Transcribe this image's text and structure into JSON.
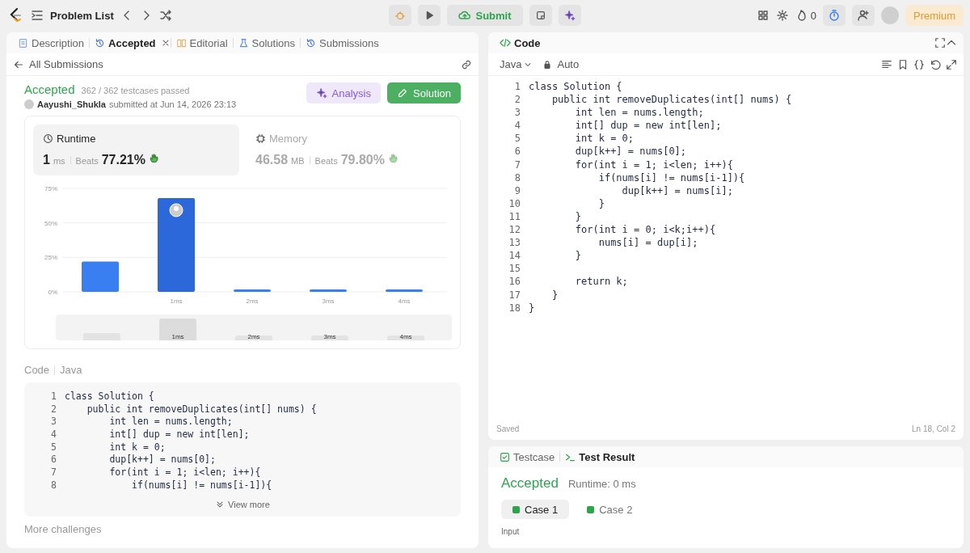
{
  "topbar": {
    "title": "Problem List",
    "submit": "Submit",
    "streak": "0",
    "premium": "Premium"
  },
  "left_tabs": [
    {
      "label": "Description",
      "selected": false,
      "kind": "doc"
    },
    {
      "label": "Accepted",
      "selected": true,
      "kind": "history",
      "closable": true
    },
    {
      "label": "Editorial",
      "selected": false,
      "kind": "book"
    },
    {
      "label": "Solutions",
      "selected": false,
      "kind": "flask"
    },
    {
      "label": "Submissions",
      "selected": false,
      "kind": "history"
    }
  ],
  "back_link": "All Submissions",
  "submission": {
    "status": "Accepted",
    "tests": "362 / 362 testcases passed",
    "user": "Aayushi_Shukla",
    "submitted": "submitted at Jun 14, 2026 23:13",
    "analysis": "Analysis",
    "solution": "Solution"
  },
  "metrics": [
    {
      "label": "Runtime",
      "kind": "clock",
      "value": "1",
      "unit": "ms",
      "beats_label": "Beats",
      "beats": "77.21%",
      "selected": true
    },
    {
      "label": "Memory",
      "kind": "chip",
      "value": "46.58",
      "unit": "MB",
      "beats_label": "Beats",
      "beats": "79.80%",
      "selected": false
    }
  ],
  "chart_data": {
    "type": "bar",
    "categories": [
      null,
      "1ms",
      "2ms",
      "3ms",
      "4ms"
    ],
    "values": [
      22,
      68,
      1,
      1,
      1
    ],
    "ylim": [
      0,
      75
    ],
    "yticks": [
      {
        "value": 0,
        "label": "0%"
      },
      {
        "value": 25,
        "label": "25%"
      },
      {
        "value": 50,
        "label": "50%"
      },
      {
        "value": 75,
        "label": "75%"
      }
    ],
    "annotations": [
      {
        "x": "1ms"
      }
    ]
  },
  "overview_labels": [
    "1ms",
    "2ms",
    "3ms",
    "4ms"
  ],
  "code_preview": {
    "title": "Code",
    "language": "Java",
    "view_more": "View more",
    "lines": [
      {
        "n": "1",
        "text": "class Solution {"
      },
      {
        "n": "2",
        "text": "    public int removeDuplicates(int[] nums) {"
      },
      {
        "n": "3",
        "text": "        int len = nums.length;"
      },
      {
        "n": "4",
        "text": "        int[] dup = new int[len];"
      },
      {
        "n": "5",
        "text": "        int k = 0;"
      },
      {
        "n": "6",
        "text": "        dup[k++] = nums[0];"
      },
      {
        "n": "7",
        "text": "        for(int i = 1; i<len; i++){"
      },
      {
        "n": "8",
        "text": "            if(nums[i] != nums[i-1]){"
      }
    ]
  },
  "more_challenges": "More challenges",
  "editor": {
    "title": "Code",
    "language": "Java",
    "mode": "Auto",
    "status": "Saved",
    "cursor": "Ln 18, Col 2",
    "lines": [
      {
        "n": "1",
        "text": "class Solution {"
      },
      {
        "n": "2",
        "text": "    public int removeDuplicates(int[] nums) {"
      },
      {
        "n": "3",
        "text": "        int len = nums.length;"
      },
      {
        "n": "4",
        "text": "        int[] dup = new int[len];"
      },
      {
        "n": "5",
        "text": "        int k = 0;"
      },
      {
        "n": "6",
        "text": "        dup[k++] = nums[0];"
      },
      {
        "n": "7",
        "text": "        for(int i = 1; i<len; i++){"
      },
      {
        "n": "8",
        "text": "            if(nums[i] != nums[i-1]){"
      },
      {
        "n": "9",
        "text": "                dup[k++] = nums[i];"
      },
      {
        "n": "10",
        "text": "            }"
      },
      {
        "n": "11",
        "text": "        }"
      },
      {
        "n": "12",
        "text": "        for(int i = 0; i<k;i++){"
      },
      {
        "n": "13",
        "text": "            nums[i] = dup[i];"
      },
      {
        "n": "14",
        "text": "        }"
      },
      {
        "n": "15"
      },
      {
        "n": "16",
        "text": "        return k;"
      },
      {
        "n": "17",
        "text": "    }"
      },
      {
        "n": "18",
        "text": "}"
      }
    ]
  },
  "result_tabs": [
    {
      "label": "Testcase",
      "selected": false,
      "kind": "check"
    },
    {
      "label": "Test Result",
      "selected": true,
      "kind": "terminal"
    }
  ],
  "result": {
    "status": "Accepted",
    "runtime": "Runtime: 0 ms",
    "input_label": "Input",
    "cases": [
      {
        "label": "Case 1",
        "selected": true,
        "passed": true
      },
      {
        "label": "Case 2",
        "selected": false,
        "passed": true
      }
    ]
  }
}
